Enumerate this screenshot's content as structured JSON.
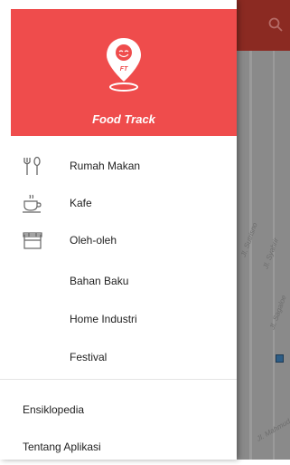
{
  "app": {
    "brand": "Food Track",
    "logo_monogram": "FT"
  },
  "menu": [
    {
      "label": "Rumah Makan",
      "icon": "utensils-icon"
    },
    {
      "label": "Kafe",
      "icon": "coffee-cup-icon"
    },
    {
      "label": "Oleh-oleh",
      "icon": "gift-box-icon"
    },
    {
      "label": "Bahan Baku",
      "icon": ""
    },
    {
      "label": "Home Industri",
      "icon": ""
    },
    {
      "label": "Festival",
      "icon": ""
    }
  ],
  "secondary_menu": [
    {
      "label": "Ensiklopedia"
    },
    {
      "label": "Tentang Aplikasi"
    }
  ],
  "map": {
    "road_labels": [
      "Jl. Sutrisno",
      "Jl. Syahrir",
      "Jl. Sagaloe",
      "Jl. Mahmud"
    ]
  },
  "colors": {
    "brand_red": "#ef4c4c",
    "topbar_dim": "#8b2a22",
    "scrim": "#8a8a8a"
  }
}
